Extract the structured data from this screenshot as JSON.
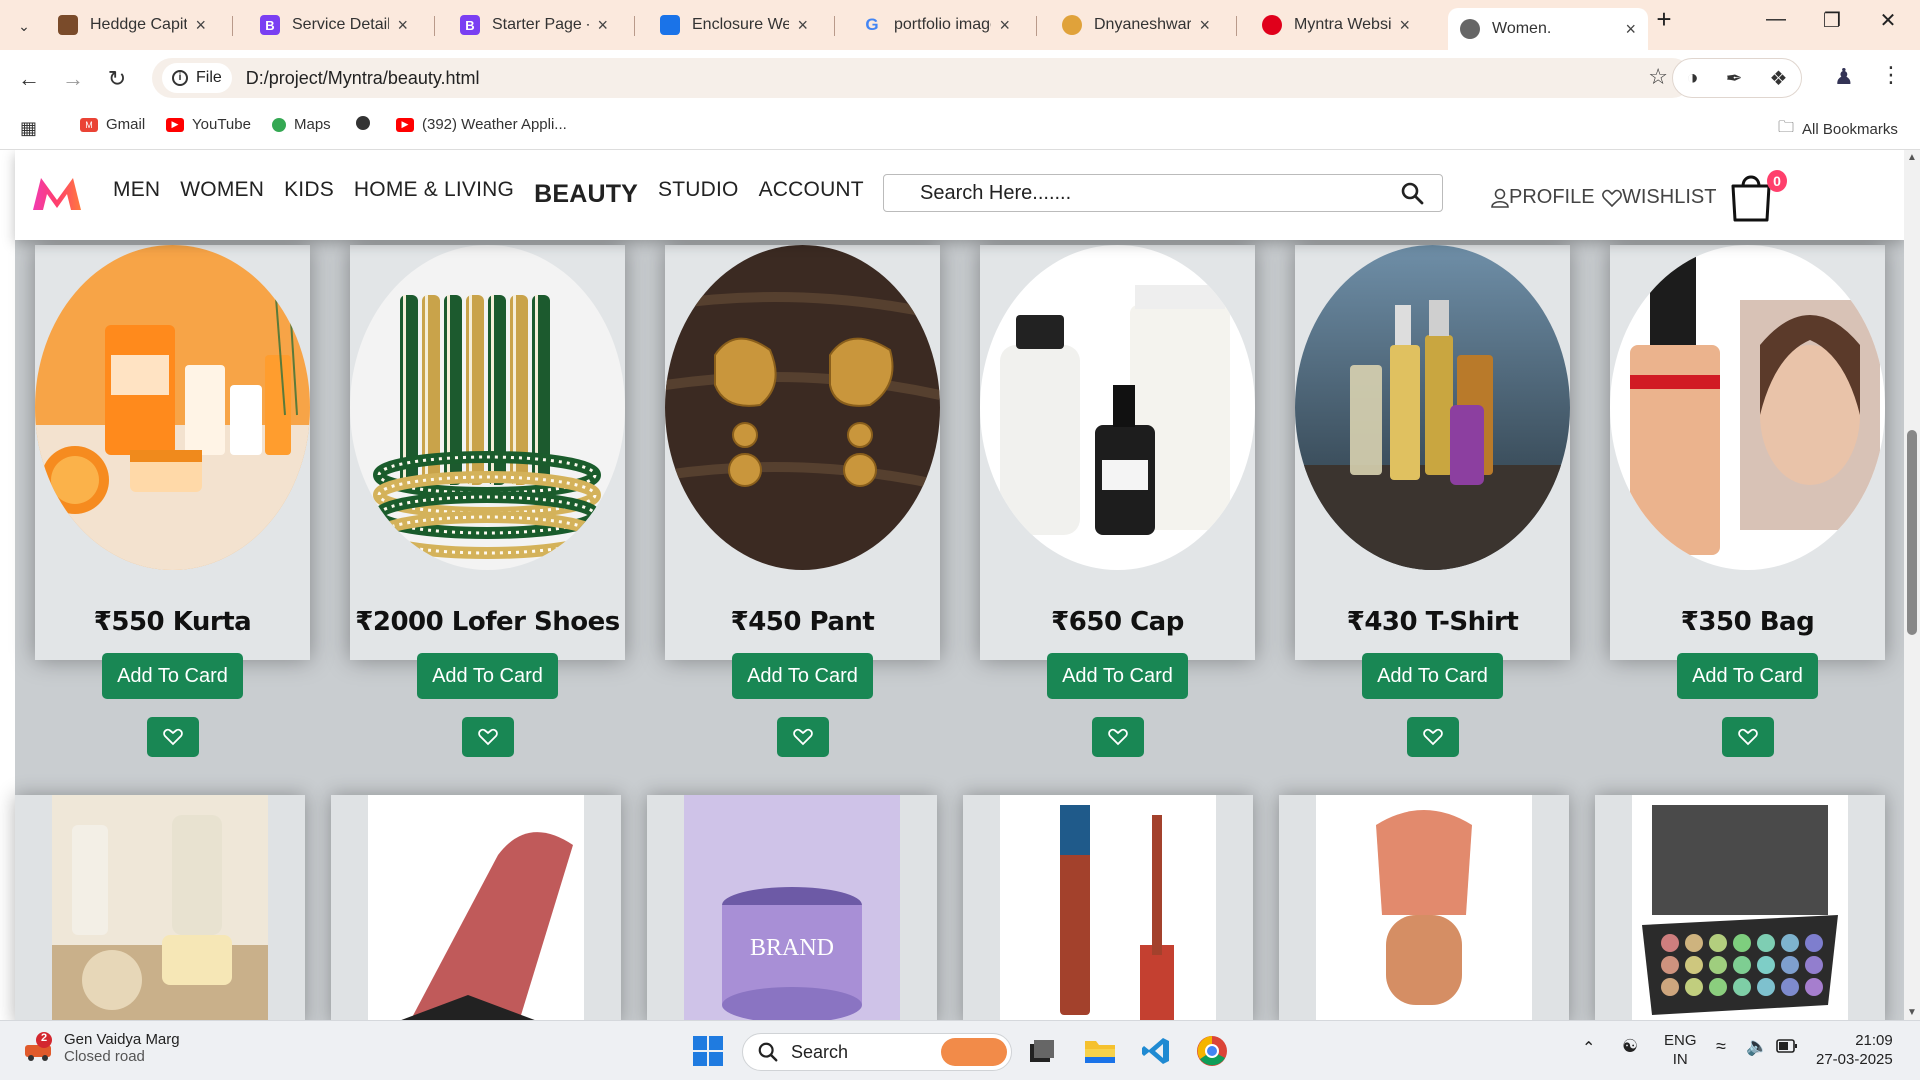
{
  "browser": {
    "tabs": [
      {
        "title": "Heddge Capitals",
        "favicon": "heddge-favicon-icon",
        "color": "#7a4b2a"
      },
      {
        "title": "Service Details -",
        "favicon": "bootstrap-icon",
        "color": "#7a3ff2"
      },
      {
        "title": "Starter Page - iP",
        "favicon": "bootstrap-icon",
        "color": "#7a3ff2"
      },
      {
        "title": "Enclosure Websi",
        "favicon": "enclosure-icon",
        "color": "#1a73e8"
      },
      {
        "title": "portfolio images",
        "favicon": "google-icon",
        "color": "#4285f4"
      },
      {
        "title": "Dnyaneshwari P",
        "favicon": "github-avatar-icon",
        "color": "#e0a23a"
      },
      {
        "title": "Myntra Website",
        "favicon": "youtube-record-icon",
        "color": "#e0001b"
      },
      {
        "title": "Women.",
        "favicon": "globe-icon",
        "color": "#666666"
      }
    ],
    "address": {
      "chip": "File",
      "url": "D:/project/Myntra/beauty.html"
    },
    "bookmarks": [
      {
        "label": "Gmail",
        "icon": "gmail-icon"
      },
      {
        "label": "YouTube",
        "icon": "youtube-icon"
      },
      {
        "label": "Maps",
        "icon": "maps-icon"
      },
      {
        "label": "",
        "icon": "globe-icon"
      },
      {
        "label": "(392) Weather Appli...",
        "icon": "youtube-icon"
      }
    ],
    "all_bookmarks": "All Bookmarks"
  },
  "site": {
    "menu": [
      "MEN",
      "WOMEN",
      "KIDS",
      "HOME & LIVING",
      "BEAUTY",
      "STUDIO",
      "ACCOUNT"
    ],
    "search_placeholder": "Search Here.......",
    "profile": "PROFILE",
    "wishlist": "WISHLIST",
    "bag_count": "0",
    "accent": "#ff3f6c",
    "button_color": "#198754"
  },
  "products": [
    {
      "price": "₹550 Kurta",
      "button": "Add To Card",
      "image": "orange-skincare-products"
    },
    {
      "price": "₹2000 Lofer Shoes",
      "button": "Add To Card",
      "image": "green-pearl-bangles"
    },
    {
      "price": "₹450 Pant",
      "button": "Add To Card",
      "image": "gold-peacock-earrings"
    },
    {
      "price": "₹650 Cap",
      "button": "Add To Card",
      "image": "minimalist-serum-bottles"
    },
    {
      "price": "₹430 T-Shirt",
      "button": "Add To Card",
      "image": "perfume-bottles"
    },
    {
      "price": "₹350 Bag",
      "button": "Add To Card",
      "image": "foundation-bottle-model"
    }
  ],
  "row2_images": [
    "soap-bath-products",
    "lipstick",
    "brand-cream-jar",
    "kiro-lip-gloss",
    "makeup-brush",
    "eyeshadow-palette"
  ],
  "taskbar": {
    "weather_title": "Gen Vaidya Marg",
    "weather_sub": "Closed road",
    "weather_badge": "2",
    "search": "Search",
    "lang1": "ENG",
    "lang2": "IN",
    "time": "21:09",
    "date": "27-03-2025"
  }
}
